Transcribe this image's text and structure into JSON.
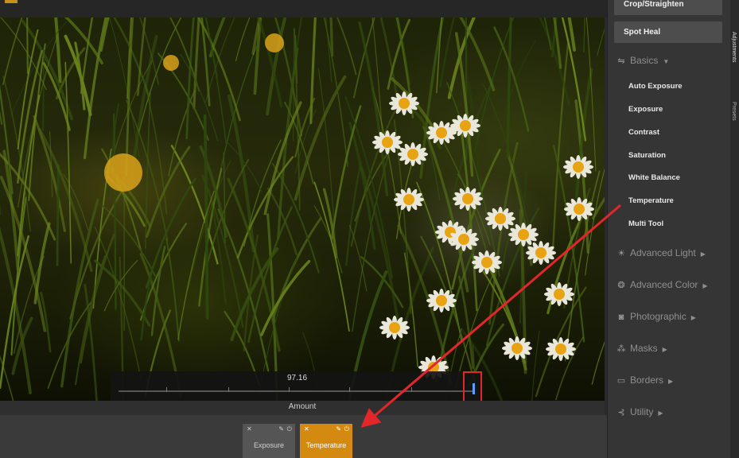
{
  "slider": {
    "value": "97.16",
    "label": "Amount"
  },
  "filters": [
    {
      "name": "Exposure",
      "active": false
    },
    {
      "name": "Temperature",
      "active": true
    }
  ],
  "panel": {
    "buttons": [
      "Crop/Straighten",
      "Spot Heal"
    ],
    "basics": {
      "label": "Basics",
      "icon": "sliders-icon"
    },
    "basic_tools": [
      "Auto Exposure",
      "Exposure",
      "Contrast",
      "Saturation",
      "White Balance",
      "Temperature",
      "Multi Tool"
    ],
    "sections": [
      {
        "label": "Advanced Light",
        "icon": "sun-icon"
      },
      {
        "label": "Advanced Color",
        "icon": "color-circles-icon"
      },
      {
        "label": "Photographic",
        "icon": "camera-icon"
      },
      {
        "label": "Masks",
        "icon": "mask-icon"
      },
      {
        "label": "Borders",
        "icon": "border-icon"
      },
      {
        "label": "Utility",
        "icon": "utility-icon"
      }
    ]
  },
  "side_tabs": [
    "Adjustments",
    "Presets"
  ],
  "colors": {
    "accent": "#d48a10",
    "highlight": "#e3262a",
    "handle": "#5aa0ff"
  }
}
